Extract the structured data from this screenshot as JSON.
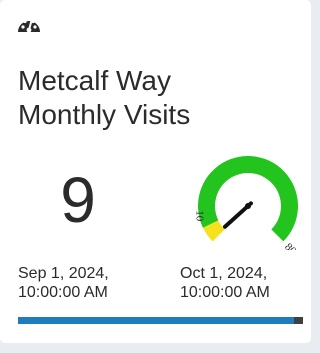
{
  "widget": {
    "icon": "gauge-icon",
    "title_line1": "Metcalf Way",
    "title_line2": "Monthly Visits",
    "value": "9",
    "gauge": {
      "min_label": "10",
      "max_label": "80",
      "min": 10,
      "max": 80,
      "needle_value": 9,
      "warning_band": [
        10,
        15
      ],
      "ok_band": [
        15,
        80
      ],
      "colors": {
        "warning": "#f5e21c",
        "ok": "#22c41d",
        "needle": "#111111"
      }
    },
    "start_date": {
      "line1": "Sep 1, 2024,",
      "line2": "10:00:00 AM"
    },
    "end_date": {
      "line1": "Oct 1, 2024,",
      "line2": "10:00:00 AM"
    },
    "progress": {
      "fraction": 0.97,
      "fill_color": "#1f7dbd",
      "track_color": "#404040"
    }
  }
}
